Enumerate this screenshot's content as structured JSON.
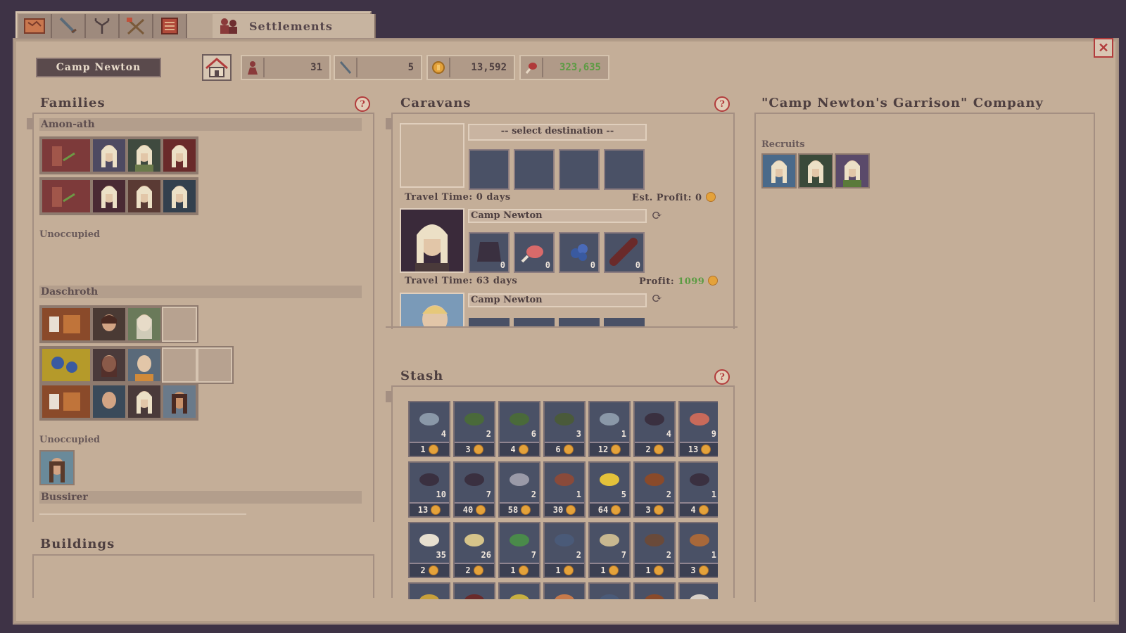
{
  "tabs": {
    "icons": [
      "map-icon",
      "sword-icon",
      "tree-icon",
      "crossed-tools-icon",
      "ledger-icon",
      "people-icon"
    ],
    "active_label": "Settlements"
  },
  "header": {
    "settlement_name": "Camp Newton",
    "population": "31",
    "soldiers": "5",
    "gold": "13,592",
    "food": "323,635"
  },
  "families": {
    "title": "Families",
    "groups": [
      {
        "name": "Amon-ath"
      },
      {
        "name": "Daschroth"
      },
      {
        "name": "Bussirer"
      }
    ],
    "unoccupied_label": "Unoccupied"
  },
  "buildings": {
    "title": "Buildings"
  },
  "caravans": {
    "title": "Caravans",
    "select_destination": "-- select destination --",
    "new": {
      "travel_time": "Travel Time: 0 days",
      "est_profit_label": "Est. Profit:",
      "est_profit_value": "0"
    },
    "caravan1": {
      "destination": "Camp Newton",
      "goods": [
        "0",
        "0",
        "0",
        "0"
      ],
      "travel_time": "Travel Time: 63 days",
      "profit_label": "Profit:",
      "profit_value": "1099"
    },
    "caravan2": {
      "destination": "Camp Newton"
    }
  },
  "company": {
    "title": "\"Camp Newton's Garrison\" Company",
    "recruits_label": "Recruits"
  },
  "stash": {
    "title": "Stash",
    "rows": [
      [
        {
          "c": "4",
          "p": "1"
        },
        {
          "c": "2",
          "p": "3"
        },
        {
          "c": "6",
          "p": "4"
        },
        {
          "c": "3",
          "p": "6"
        },
        {
          "c": "1",
          "p": "12"
        },
        {
          "c": "4",
          "p": "2"
        },
        {
          "c": "9",
          "p": "13"
        }
      ],
      [
        {
          "c": "10",
          "p": "13"
        },
        {
          "c": "7",
          "p": "40"
        },
        {
          "c": "2",
          "p": "58"
        },
        {
          "c": "1",
          "p": "30"
        },
        {
          "c": "5",
          "p": "64"
        },
        {
          "c": "2",
          "p": "3"
        },
        {
          "c": "1",
          "p": "4"
        }
      ],
      [
        {
          "c": "35",
          "p": "2"
        },
        {
          "c": "26",
          "p": "2"
        },
        {
          "c": "7",
          "p": "1"
        },
        {
          "c": "2",
          "p": "1"
        },
        {
          "c": "7",
          "p": "1"
        },
        {
          "c": "2",
          "p": "1"
        },
        {
          "c": "1",
          "p": "3"
        }
      ]
    ]
  },
  "colors": {
    "panel": "#c4ae98",
    "slot": "#4a5166",
    "profit_green": "#5c9b43",
    "alert_red": "#b23c3c",
    "coin": "#e4a23a"
  }
}
